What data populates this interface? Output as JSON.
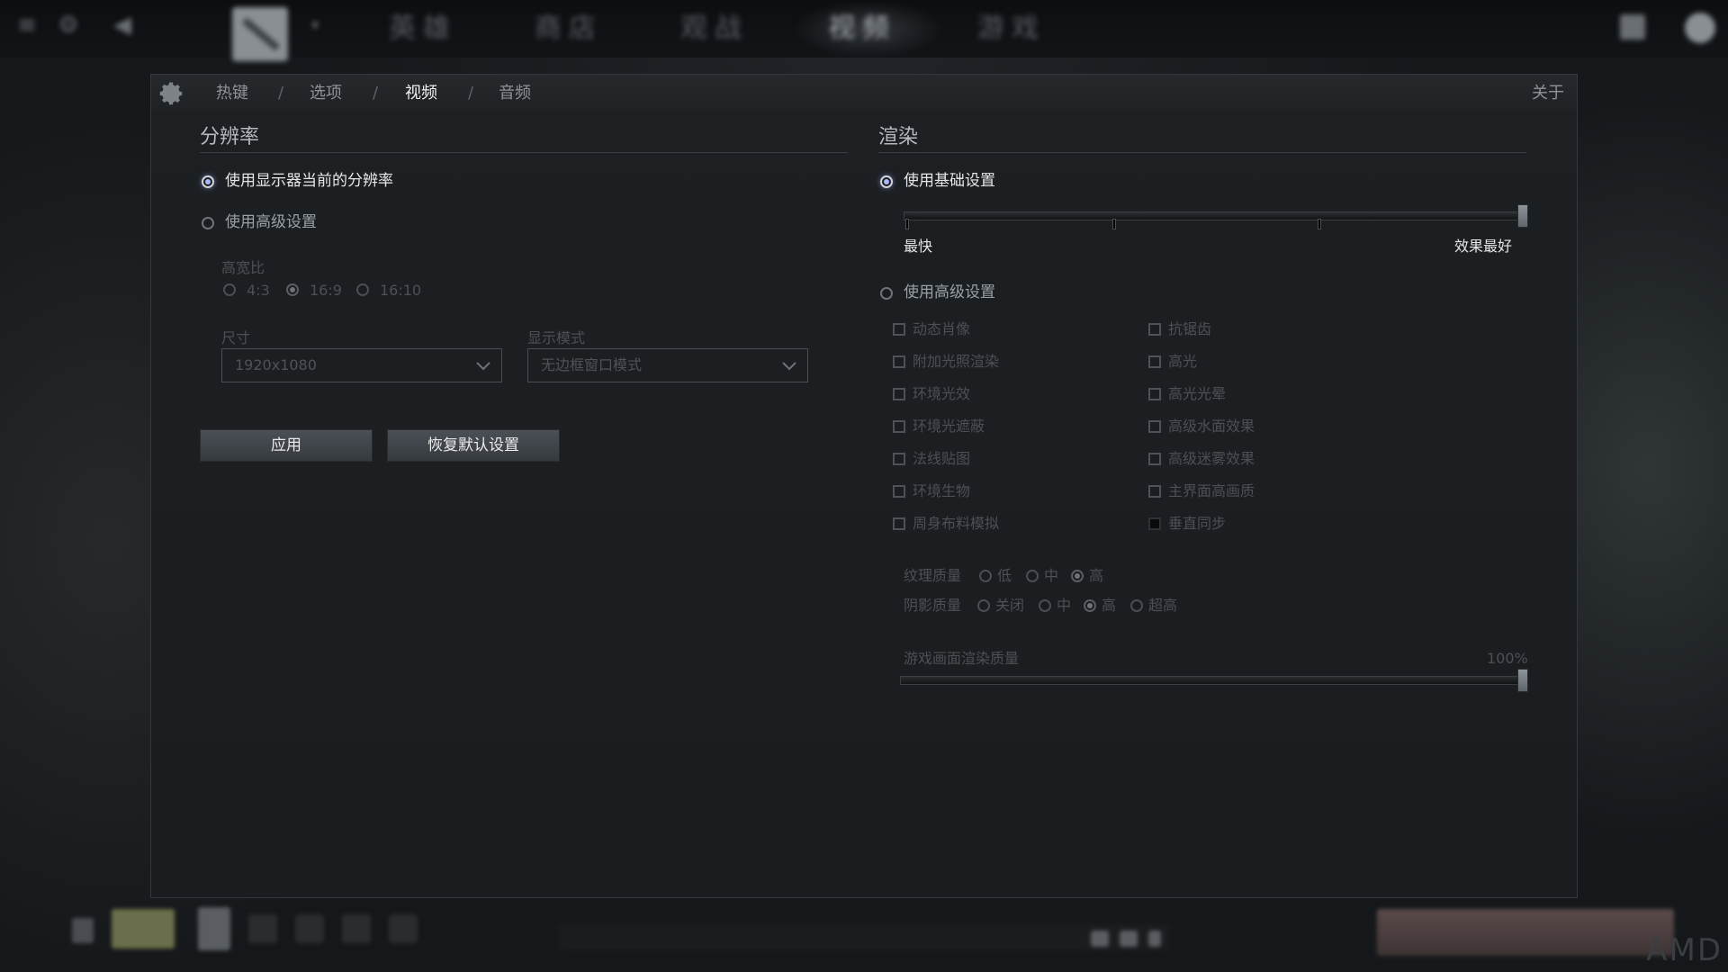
{
  "topbar": {
    "tabs": [
      "英雄",
      "商店",
      "观战",
      "视频",
      "游戏"
    ],
    "active_tab_index": 3
  },
  "header": {
    "breadcrumbs": [
      "热键",
      "选项",
      "视频",
      "音频"
    ],
    "separator": "/",
    "active_index": 2,
    "about": "关于"
  },
  "resolution": {
    "title": "分辨率",
    "option_display": "使用显示器当前的分辨率",
    "option_advanced": "使用高级设置",
    "selected": "display",
    "aspect_label": "高宽比",
    "aspect_options": [
      "4:3",
      "16:9",
      "16:10"
    ],
    "aspect_selected": "16:9",
    "size_label": "尺寸",
    "size_value": "1920x1080",
    "mode_label": "显示模式",
    "mode_value": "无边框窗口模式",
    "apply_button": "应用",
    "reset_button": "恢复默认设置"
  },
  "render": {
    "title": "渲染",
    "option_basic": "使用基础设置",
    "option_advanced": "使用高级设置",
    "selected": "basic",
    "slider_min_label": "最快",
    "slider_max_label": "效果最好",
    "slider_value_fraction": 1.0,
    "checkboxes_left": [
      "动态肖像",
      "附加光照渲染",
      "环境光效",
      "环境光遮蔽",
      "法线贴图",
      "环境生物",
      "周身布料模拟"
    ],
    "checkboxes_right": [
      "抗锯齿",
      "高光",
      "高光光晕",
      "高级水面效果",
      "高级迷雾效果",
      "主界面高画质",
      "垂直同步"
    ],
    "texture_label": "纹理质量",
    "texture_options": [
      "低",
      "中",
      "高"
    ],
    "texture_selected": "高",
    "shadow_label": "阴影质量",
    "shadow_options": [
      "关闭",
      "中",
      "高",
      "超高"
    ],
    "shadow_selected": "高",
    "render_quality_label": "游戏画面渲染质量",
    "render_quality_value": "100%",
    "render_quality_fraction": 1.0
  },
  "footer": {
    "brand": "AMD"
  }
}
